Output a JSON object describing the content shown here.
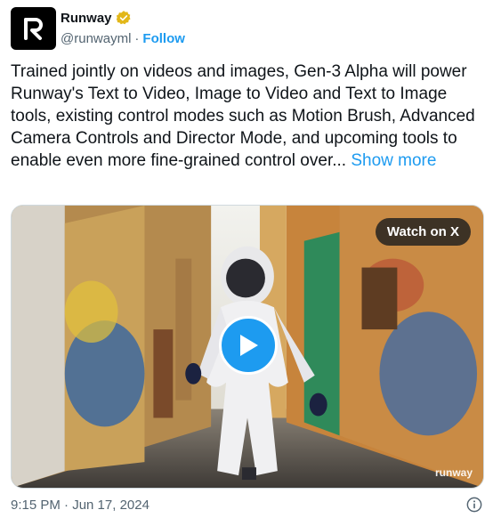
{
  "author": {
    "name": "Runway",
    "handle": "@runwayml",
    "separator": "·",
    "follow_label": "Follow",
    "verified_badge_color": "#e2b719",
    "avatar_icon": "runway-logo-icon"
  },
  "tweet": {
    "text": "Trained jointly on videos and images, Gen-3 Alpha will power Runway's Text to Video, Image to Video and Text to Image tools, existing control modes such as Motion Brush, Advanced Camera Controls and Director Mode, and upcoming tools to enable even more fine-grained control over...",
    "show_more_label": "Show more"
  },
  "media": {
    "watch_label": "Watch on X",
    "watermark": "runway",
    "play_icon": "play-icon",
    "accent_color": "#1d9bf0"
  },
  "footer": {
    "timestamp": "9:15 PM · Jun 17, 2024",
    "info_icon": "info-icon"
  }
}
